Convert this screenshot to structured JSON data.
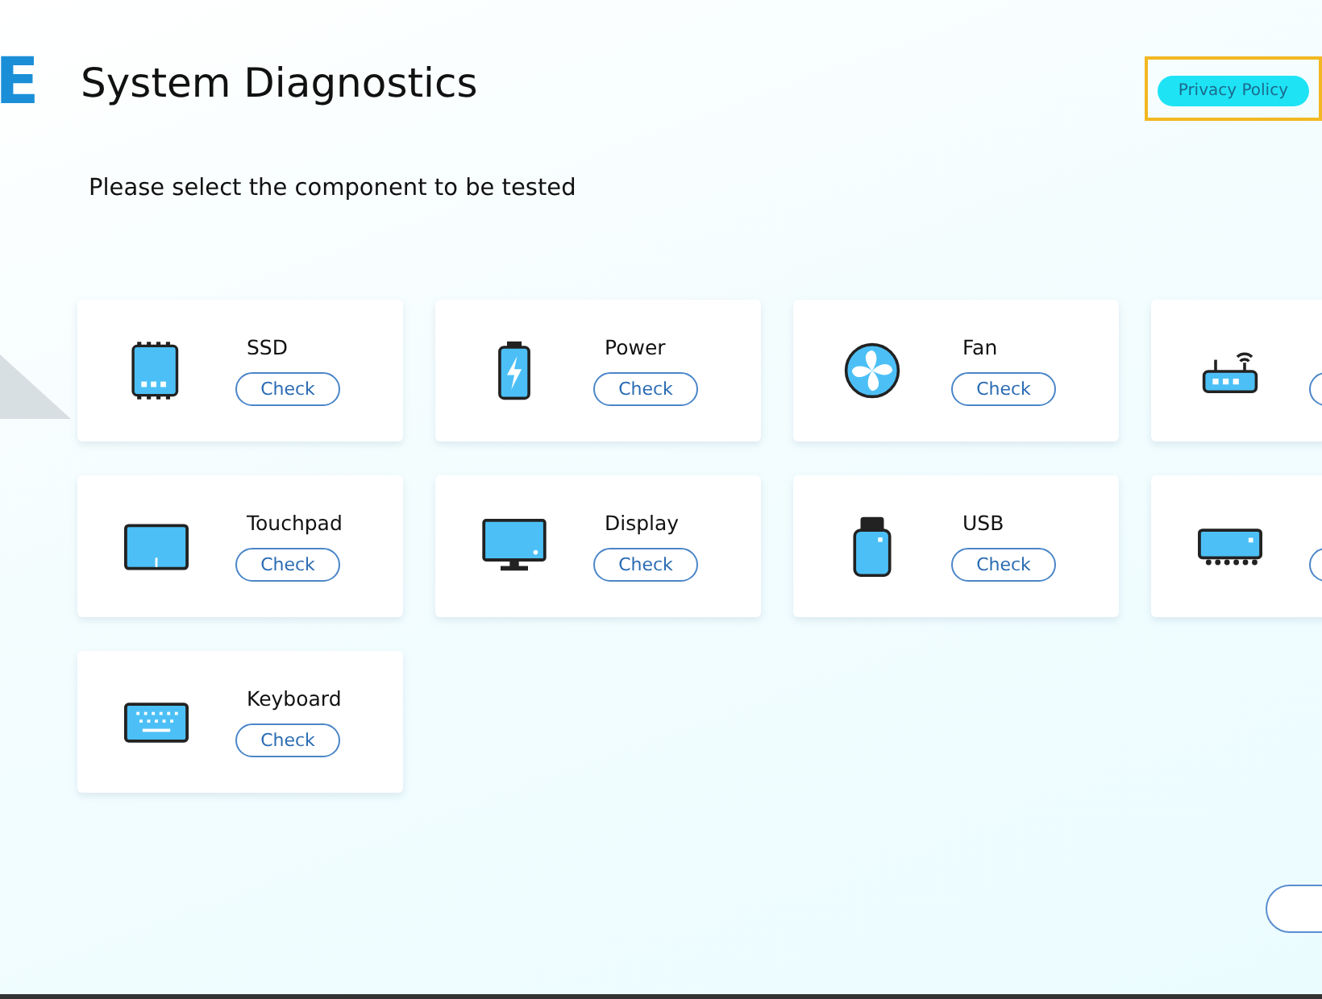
{
  "header": {
    "logo_text": "E",
    "title": "System Diagnostics",
    "privacy_button": {
      "label": "Privacy Policy",
      "focused": true
    }
  },
  "prompt": "Please select the component to be tested",
  "components": [
    {
      "kind": "ssd",
      "label": "SSD",
      "button": "Check"
    },
    {
      "kind": "battery",
      "label": "Power",
      "button": "Check"
    },
    {
      "kind": "fan",
      "label": "Fan",
      "button": "Check"
    },
    {
      "kind": "router"
    },
    {
      "kind": "touchpad",
      "label": "Touchpad",
      "button": "Check"
    },
    {
      "kind": "display",
      "label": "Display",
      "button": "Check"
    },
    {
      "kind": "usb",
      "label": "USB",
      "button": "Check"
    },
    {
      "kind": "ports"
    },
    {
      "kind": "keyboard",
      "label": "Keyboard",
      "button": "Check"
    }
  ]
}
